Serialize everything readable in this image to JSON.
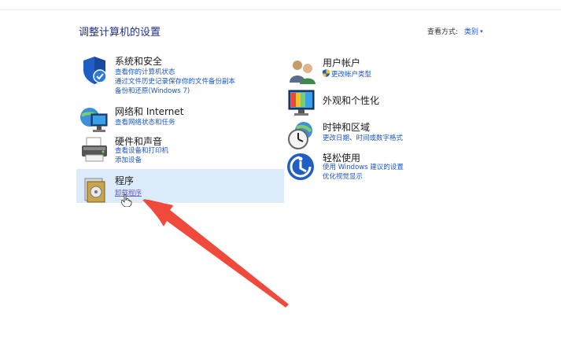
{
  "header": {
    "title": "调整计算机的设置",
    "view_by_label": "查看方式:",
    "view_by_value": "类别"
  },
  "left_column": [
    {
      "title": "系统和安全",
      "icon": "shield-icon",
      "links": [
        "查看你的计算机状态",
        "通过文件历史记录保存你的文件备份副本",
        "备份和还原(Windows 7)"
      ]
    },
    {
      "title": "网络和 Internet",
      "icon": "network-icon",
      "links": [
        "查看网络状态和任务"
      ]
    },
    {
      "title": "硬件和声音",
      "icon": "printer-icon",
      "links": [
        "查看设备和打印机",
        "添加设备"
      ]
    },
    {
      "title": "程序",
      "icon": "programs-icon",
      "links": [
        "卸载程序"
      ]
    }
  ],
  "right_column": [
    {
      "title": "用户帐户",
      "icon": "users-icon",
      "links": [
        "更改帐户类型"
      ]
    },
    {
      "title": "外观和个性化",
      "icon": "monitor-icon",
      "links": []
    },
    {
      "title": "时钟和区域",
      "icon": "clock-globe-icon",
      "links": [
        "更改日期、时间或数字格式"
      ]
    },
    {
      "title": "轻松使用",
      "icon": "ease-of-access-icon",
      "links": [
        "使用 Windows 建议的设置",
        "优化视觉显示"
      ]
    }
  ],
  "colors": {
    "link": "#1a55c8",
    "title": "#1e3287",
    "highlight": "#dcebfa",
    "arrow": "#f04a3c"
  }
}
